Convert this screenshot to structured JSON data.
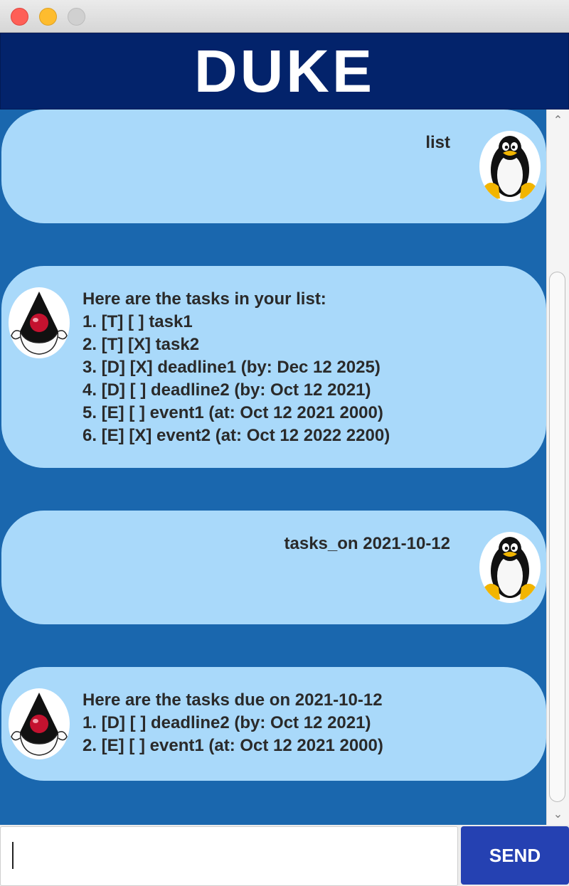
{
  "window": {
    "title_visible": false
  },
  "header": {
    "title": "DUKE"
  },
  "messages": [
    {
      "sender": "user",
      "text": "list"
    },
    {
      "sender": "duke",
      "text": "Here are the tasks in your list:\n1. [T] [ ] task1\n2. [T] [X] task2\n3. [D] [X] deadline1 (by: Dec 12 2025)\n4. [D] [ ] deadline2 (by: Oct 12 2021)\n5. [E] [ ] event1 (at: Oct 12 2021 2000)\n6. [E] [X] event2 (at: Oct 12 2022 2200)"
    },
    {
      "sender": "user",
      "text": "tasks_on 2021-10-12"
    },
    {
      "sender": "duke",
      "text": "Here are the tasks due on 2021-10-12\n1. [D] [ ] deadline2 (by: Oct 12 2021)\n2. [E] [ ] event1 (at: Oct 12 2021 2000)"
    }
  ],
  "input": {
    "value": "",
    "placeholder": ""
  },
  "send_button": {
    "label": "SEND"
  },
  "colors": {
    "header_bg": "#03236b",
    "chat_bg": "#1a67ae",
    "bubble_bg": "#a9d9fa",
    "send_bg": "#2541b2"
  },
  "icons": {
    "user_avatar": "penguin-icon",
    "bot_avatar": "duke-mascot-icon",
    "window_close": "close-light",
    "window_minimize": "minimize-light",
    "window_maximize": "maximize-light"
  }
}
